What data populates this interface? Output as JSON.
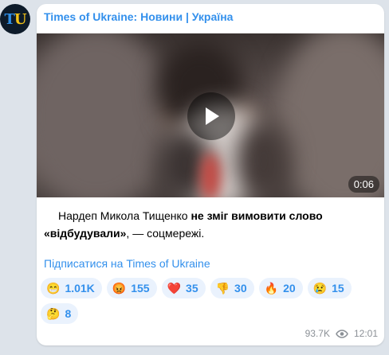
{
  "avatar": {
    "t": "T",
    "u": "U"
  },
  "post": {
    "channel": "Times of Ukraine: Новини | Україна",
    "video": {
      "duration": "0:06"
    },
    "text": {
      "p1": "Нардеп Микола Тищенко ",
      "b1": "не зміг вимовити слово",
      "b2": "«відбудували»",
      "p2": ", — соцмережі."
    },
    "subscribe_link": "Підписатися на Times of Ukraine",
    "reactions": [
      {
        "emoji": "😁",
        "icon": "grinning-face-icon",
        "count": "1.01K"
      },
      {
        "emoji": "😡",
        "icon": "angry-face-icon",
        "count": "155"
      },
      {
        "emoji": "❤️",
        "icon": "heart-icon",
        "count": "35"
      },
      {
        "emoji": "👎",
        "icon": "thumbs-down-icon",
        "count": "30"
      },
      {
        "emoji": "🔥",
        "icon": "fire-icon",
        "count": "20"
      },
      {
        "emoji": "😢",
        "icon": "crying-face-icon",
        "count": "15"
      },
      {
        "emoji": "🤔",
        "icon": "thinking-face-icon",
        "count": "8"
      }
    ],
    "views": "93.7K",
    "time": "12:01"
  },
  "colors": {
    "accent": "#3390ec",
    "background": "#dde3ea",
    "bubble": "#ffffff",
    "reaction_bg": "#eaf2fd",
    "meta": "#8b9096"
  }
}
